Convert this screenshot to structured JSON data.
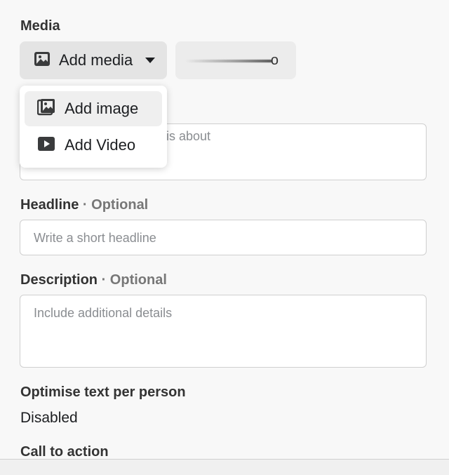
{
  "media": {
    "label": "Media",
    "add_media_label": "Add media",
    "secondary_value": "o"
  },
  "dropdown": {
    "items": [
      {
        "label": "Add image",
        "icon": "image-icon"
      },
      {
        "label": "Add Video",
        "icon": "video-icon"
      }
    ]
  },
  "primary_text": {
    "placeholder_visible": "is about"
  },
  "headline": {
    "label": "Headline",
    "optional": "· Optional",
    "placeholder": "Write a short headline"
  },
  "description": {
    "label": "Description",
    "optional": "· Optional",
    "placeholder": "Include additional details"
  },
  "optimise": {
    "label": "Optimise text per person",
    "value": "Disabled"
  },
  "cta": {
    "label": "Call to action"
  }
}
